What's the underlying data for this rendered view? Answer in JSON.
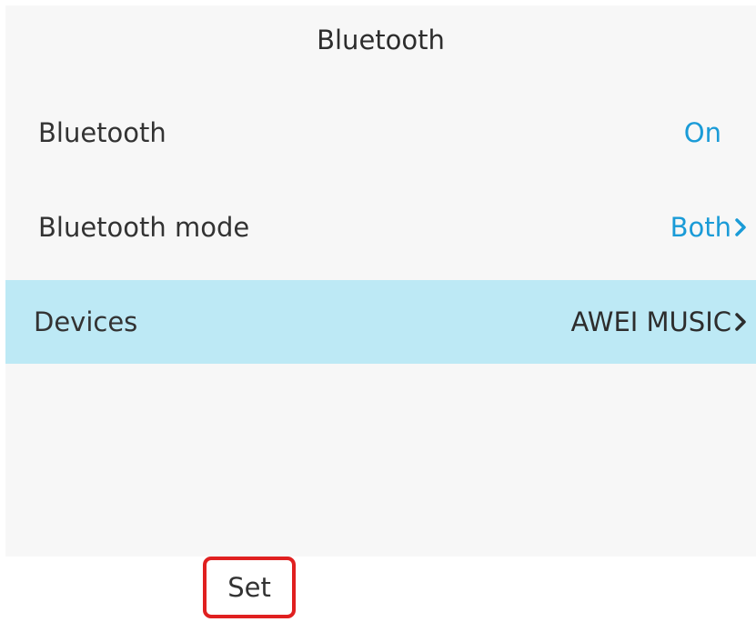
{
  "header": {
    "title": "Bluetooth"
  },
  "settings": {
    "items": [
      {
        "label": "Bluetooth",
        "value": "On",
        "has_submenu": false,
        "selected": false
      },
      {
        "label": "Bluetooth mode",
        "value": "Both",
        "has_submenu": true,
        "selected": false
      },
      {
        "label": "Devices",
        "value": "AWEI MUSIC",
        "has_submenu": true,
        "selected": true
      }
    ]
  },
  "softkeys": {
    "set_label": "Set"
  },
  "colors": {
    "accent": "#1a9bd7",
    "selected_row": "#bde9f5",
    "highlight_border": "#e02020"
  },
  "icons": {
    "submenu": "chevron-right-icon"
  }
}
